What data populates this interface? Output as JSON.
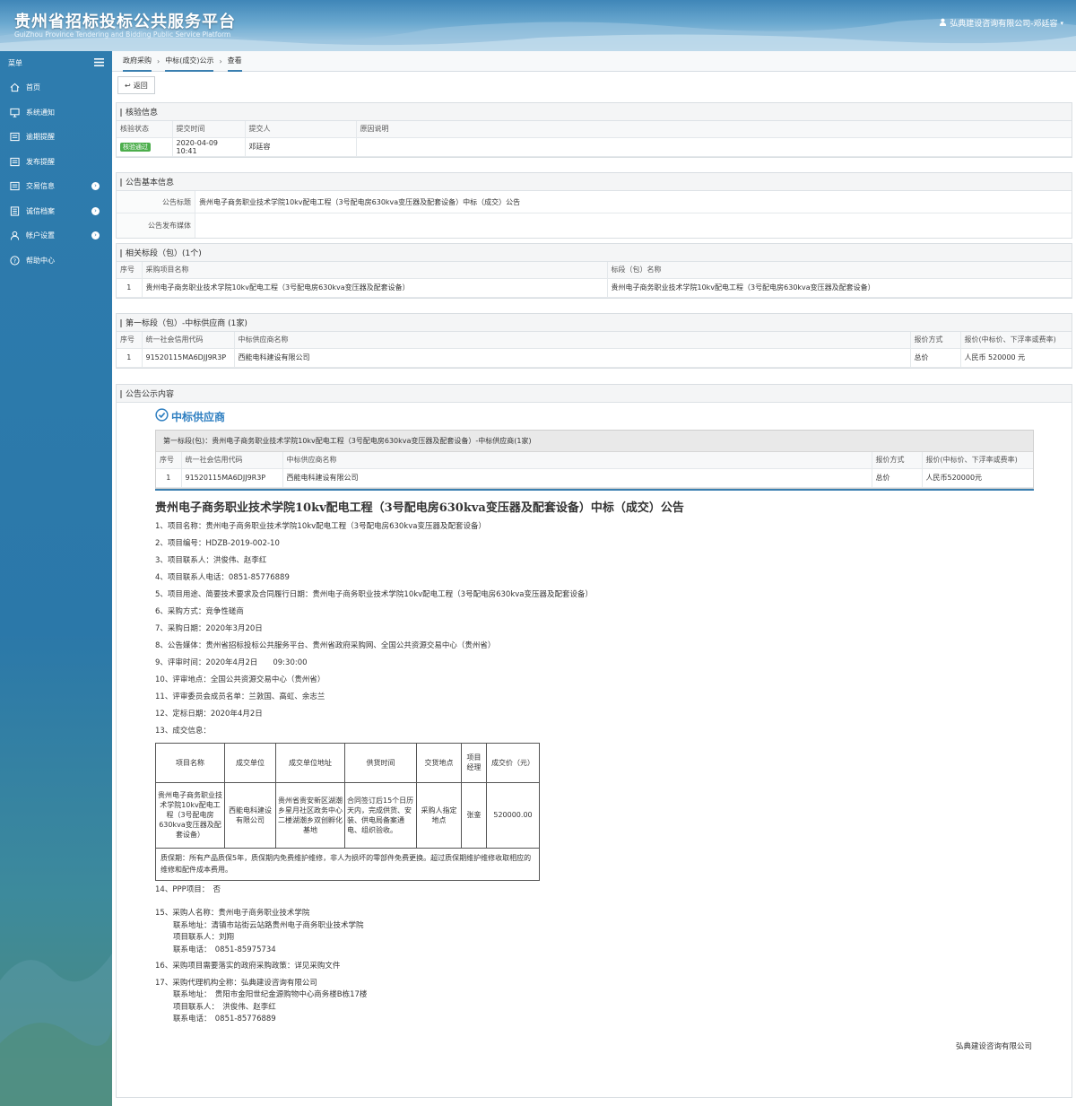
{
  "header": {
    "title_cn": "贵州省招标投标公共服务平台",
    "title_en": "GuiZhou Province Tendering and Bidding Public Service Platform",
    "user": "弘典建设咨询有限公司-邓廷容"
  },
  "sidebar": {
    "title": "菜单",
    "items": [
      {
        "label": "首页",
        "icon": "home-icon"
      },
      {
        "label": "系统通知",
        "icon": "monitor-icon"
      },
      {
        "label": "逾期提醒",
        "icon": "list-icon"
      },
      {
        "label": "发布提醒",
        "icon": "list-icon"
      },
      {
        "label": "交易信息",
        "icon": "list-icon"
      },
      {
        "label": "诚信档案",
        "icon": "archive-icon"
      },
      {
        "label": "帐户设置",
        "icon": "user-icon"
      },
      {
        "label": "帮助中心",
        "icon": "help-icon"
      }
    ]
  },
  "breadcrumb": [
    "政府采购",
    "中标(成交)公示",
    "查看"
  ],
  "back_label": "返回",
  "verify": {
    "title": "核验信息",
    "headers": [
      "核验状态",
      "提交时间",
      "提交人",
      "原因说明"
    ],
    "row": {
      "status": "核验通过",
      "time": "2020-04-09 10:41",
      "person": "邓廷容",
      "reason": ""
    }
  },
  "basic": {
    "title": "公告基本信息",
    "label_title": "公告标题",
    "value_title": "贵州电子商务职业技术学院10kv配电工程（3号配电房630kva变压器及配套设备）中标（成交）公告",
    "label_media": "公告发布媒体",
    "value_media": ""
  },
  "sections": {
    "title": "相关标段（包）(1个)",
    "headers": [
      "序号",
      "采购项目名称",
      "标段（包）名称"
    ],
    "row": [
      "1",
      "贵州电子商务职业技术学院10kv配电工程（3号配电房630kva变压器及配套设备）",
      "贵州电子商务职业技术学院10kv配电工程（3号配电房630kva变压器及配套设备）"
    ]
  },
  "winner": {
    "title": "第一标段（包）-中标供应商 (1家)",
    "headers": [
      "序号",
      "统一社会信用代码",
      "中标供应商名称",
      "报价方式",
      "报价(中标价、下浮率或费率)"
    ],
    "row": [
      "1",
      "91520115MA6DJJ9R3P",
      "西能电科建设有限公司",
      "总价",
      "人民币 520000 元"
    ]
  },
  "content": {
    "panel_title": "公告公示内容",
    "heading": "中标供应商",
    "sub_title": "第一标段(包)：贵州电子商务职业技术学院10kv配电工程（3号配电房630kva变压器及配套设备）-中标供应商(1家)",
    "headers": [
      "序号",
      "统一社会信用代码",
      "中标供应商名称",
      "报价方式",
      "报价(中标价、下浮率或费率)"
    ],
    "row": [
      "1",
      "91520115MA6DJJ9R3P",
      "西能电科建设有限公司",
      "总价",
      "人民币520000元"
    ],
    "doc_title": "贵州电子商务职业技术学院10kv配电工程（3号配电房630kva变压器及配套设备）中标（成交）公告",
    "lines": [
      "1、项目名称：贵州电子商务职业技术学院10kv配电工程（3号配电房630kva变压器及配套设备）",
      "2、项目编号：HDZB-2019-002-10",
      "3、项目联系人：洪俊伟、赵李红",
      "4、项目联系人电话：0851-85776889",
      "5、项目用途、简要技术要求及合同履行日期：贵州电子商务职业技术学院10kv配电工程（3号配电房630kva变压器及配套设备）",
      "6、采购方式：竞争性磋商",
      "7、采购日期：2020年3月20日",
      "8、公告媒体：贵州省招标投标公共服务平台、贵州省政府采购网、全国公共资源交易中心（贵州省）",
      "9、评审时间：2020年4月2日　　09:30:00",
      "10、评审地点：全国公共资源交易中心（贵州省）",
      "11、评审委员会成员名单：兰敦国、高虹、余志兰",
      "12、定标日期：2020年4月2日",
      "13、成交信息："
    ],
    "deal_headers": [
      "项目名称",
      "成交单位",
      "成交单位地址",
      "供货时间",
      "交货地点",
      "项目经理",
      "成交价（元）"
    ],
    "deal_row": [
      "贵州电子商务职业技术学院10kv配电工程（3号配电房630kva变压器及配套设备）",
      "西能电科建设有限公司",
      "贵州省贵安新区湖潮乡星月社区政务中心二楼湖潮乡双创孵化基地",
      "合同签订后15个日历天内，完成供货、安装、供电局备案通电、组织验收。",
      "采购人指定地点",
      "张銮",
      "520000.00"
    ],
    "warranty": "质保期：所有产品质保5年，质保期内免费维护维修，非人为损坏的零部件免费更换。超过质保期维护维修收取相应的维修和配件成本费用。",
    "line14": "14、PPP项目：　否",
    "line15": "15、采购人名称：贵州电子商务职业技术学院",
    "line15_sub": [
      "联系地址：清镇市站街云站路贵州电子商务职业技术学院",
      "项目联系人：刘翔",
      "联系电话：　0851-85975734"
    ],
    "line16": "16、采购项目需要落实的政府采购政策：详见采购文件",
    "line17": "17、采购代理机构全称：弘典建设咨询有限公司",
    "line17_sub": [
      "联系地址：　贵阳市金阳世纪金源购物中心商务楼B栋17楼",
      "项目联系人：　洪俊伟、赵李红",
      "联系电话：　0851-85776889"
    ],
    "signature": "弘典建设咨询有限公司"
  }
}
